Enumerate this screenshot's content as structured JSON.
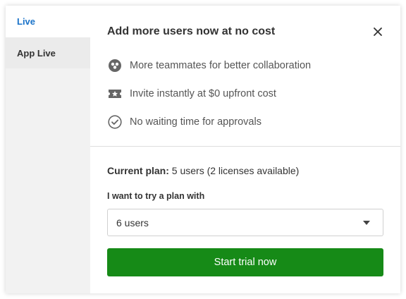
{
  "sidebar": {
    "items": [
      {
        "label": "Live",
        "active": true
      },
      {
        "label": "App Live",
        "active": false
      }
    ]
  },
  "dialog": {
    "title": "Add more users now at no cost",
    "close_icon": "close-icon",
    "features": [
      {
        "icon": "team-icon",
        "text": "More teammates for better collaboration"
      },
      {
        "icon": "ticket-star-icon",
        "text": "Invite instantly at $0 upfront cost"
      },
      {
        "icon": "check-circle-icon",
        "text": "No waiting time for approvals"
      }
    ],
    "current_plan_label": "Current plan:",
    "current_plan_value": "5 users (2 licenses available)",
    "try_label": "I want to try a plan with",
    "plan_select_value": "6 users",
    "cta_label": "Start trial now"
  },
  "colors": {
    "accent": "#1a73c9",
    "cta": "#168a17",
    "sidebar_bg": "#f2f2f2"
  }
}
